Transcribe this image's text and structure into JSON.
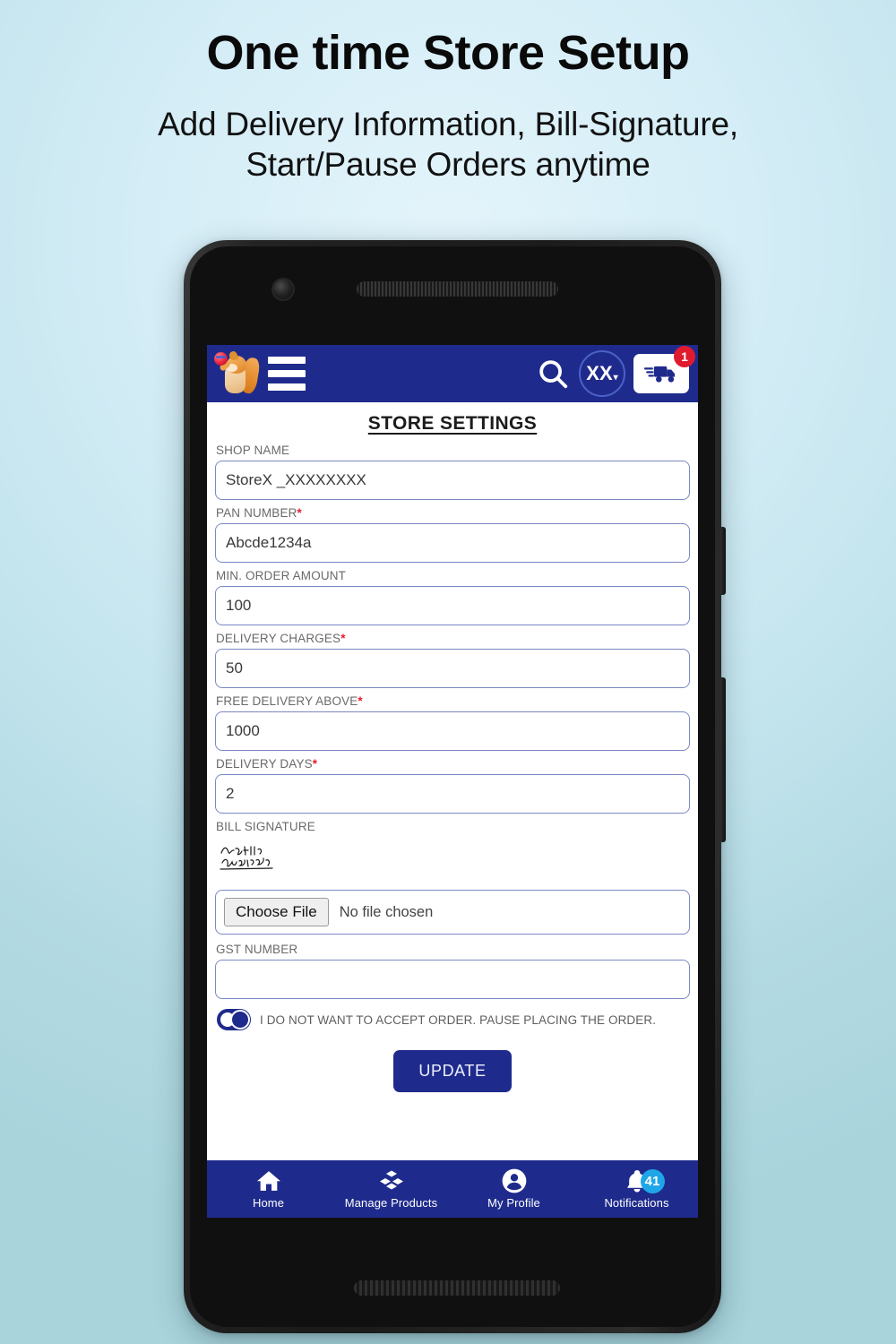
{
  "promo": {
    "title": "One time Store Setup",
    "subtitle_line1": "Add Delivery Information, Bill-Signature,",
    "subtitle_line2": "Start/Pause Orders anytime"
  },
  "appbar": {
    "logo_icon": "squirrel-mascot-icon",
    "menu_icon": "hamburger-menu-icon",
    "search_icon": "search-icon",
    "avatar_text": "XX",
    "avatar_caret": "▾",
    "truck_icon": "delivery-truck-icon",
    "cart_badge": "1"
  },
  "form": {
    "title": "STORE SETTINGS",
    "fields": [
      {
        "label": "SHOP NAME",
        "required": false,
        "value": "StoreX _XXXXXXXX"
      },
      {
        "label": "PAN NUMBER",
        "required": true,
        "value": "Abcde1234a"
      },
      {
        "label": "MIN. ORDER AMOUNT",
        "required": false,
        "value": "100"
      },
      {
        "label": "DELIVERY CHARGES",
        "required": true,
        "value": "50"
      },
      {
        "label": "FREE DELIVERY ABOVE",
        "required": true,
        "value": "1000"
      },
      {
        "label": "DELIVERY DAYS",
        "required": true,
        "value": "2"
      }
    ],
    "signature_label": "BILL SIGNATURE",
    "signature_alt": "handwritten-bill-signature",
    "file_button": "Choose File",
    "file_status": "No file chosen",
    "gst_label": "GST NUMBER",
    "gst_value": "",
    "pause_toggle_label": "I DO NOT WANT TO ACCEPT ORDER. PAUSE PLACING THE ORDER.",
    "update_button": "UPDATE",
    "required_marker": "*"
  },
  "bottomnav": [
    {
      "label": "Home",
      "icon": "home-icon"
    },
    {
      "label": "Manage Products",
      "icon": "boxes-icon"
    },
    {
      "label": "My Profile",
      "icon": "person-icon"
    },
    {
      "label": "Notifications",
      "icon": "bell-icon",
      "badge": "41"
    }
  ],
  "colors": {
    "brand_blue": "#1f2b8c",
    "badge_red": "#e01b2e",
    "badge_blue": "#1fa6e8",
    "required_red": "#e8192c",
    "background_top": "#e4f4fb",
    "background_bottom": "#a9d4dc"
  }
}
